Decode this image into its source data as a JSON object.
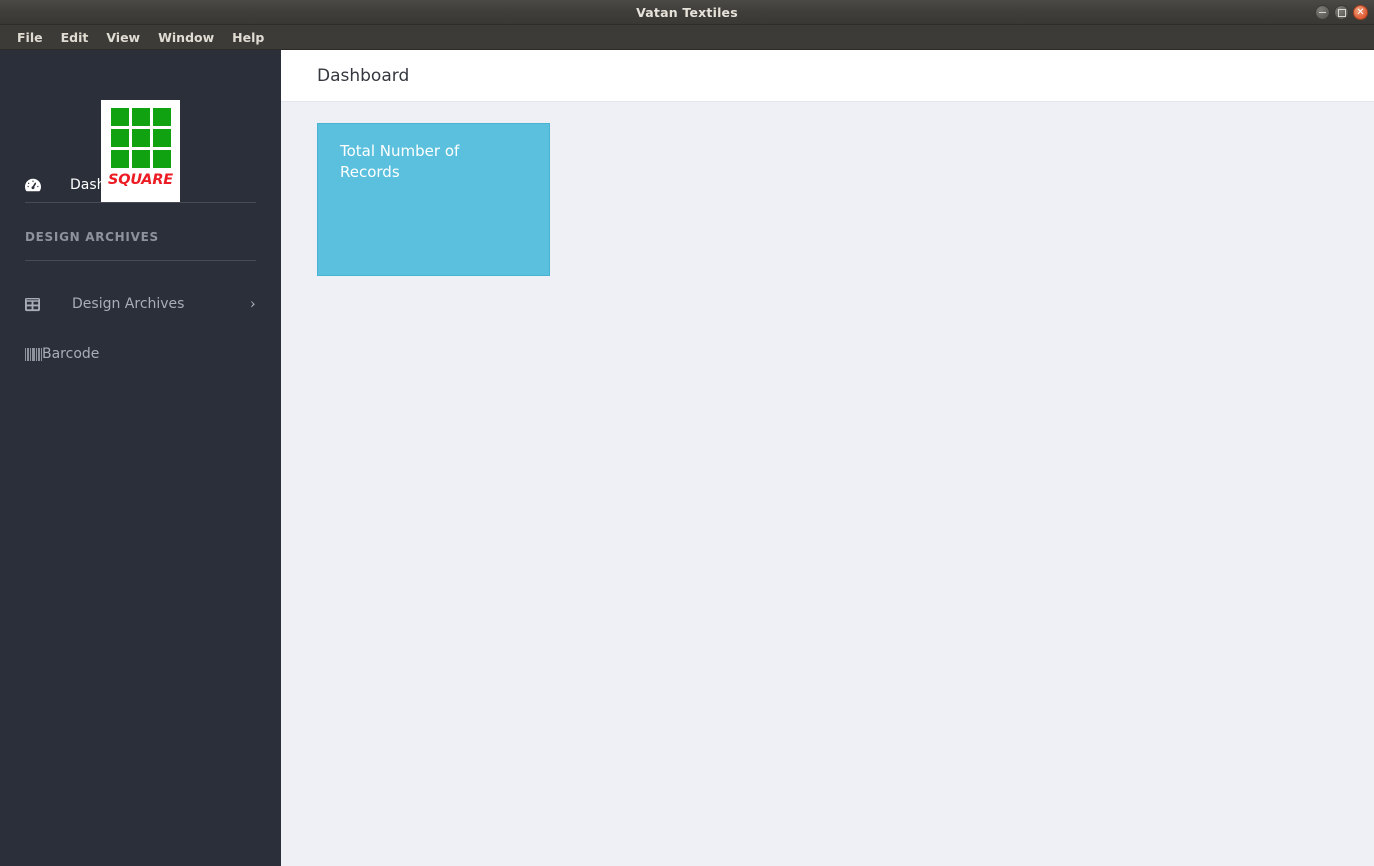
{
  "window": {
    "title": "Vatan Textiles",
    "controls": [
      {
        "name": "minimize",
        "glyph": "–"
      },
      {
        "name": "maximize",
        "glyph": "□"
      },
      {
        "name": "close",
        "glyph": "✕"
      }
    ]
  },
  "menubar": {
    "items": [
      "File",
      "Edit",
      "View",
      "Window",
      "Help"
    ]
  },
  "sidebar": {
    "logo": {
      "text": "SQUARE",
      "grid_color": "#10a210",
      "text_color": "#ed1c24",
      "background": "#ffffff",
      "cells": 9
    },
    "primary": [
      {
        "label": "Dashboard",
        "icon": "tachometer-icon",
        "active": true
      }
    ],
    "section_title": "DESIGN ARCHIVES",
    "items": [
      {
        "label": "Design Archives",
        "icon": "table-icon",
        "expand_icon": "chevron-right-icon",
        "active": false
      }
    ],
    "barcode": {
      "label": "Barcode",
      "icon": "barcode-icon"
    },
    "colors": {
      "background": "#2b2f3a",
      "text": "#a8adb8",
      "active_text": "#ffffff",
      "divider": "#474b55"
    }
  },
  "main": {
    "header": {
      "title": "Dashboard"
    },
    "cards": [
      {
        "title": "Total Number of Records",
        "value": "",
        "color": "#5bc0de",
        "text_color": "#ffffff"
      }
    ],
    "background": "#eff0f5"
  }
}
